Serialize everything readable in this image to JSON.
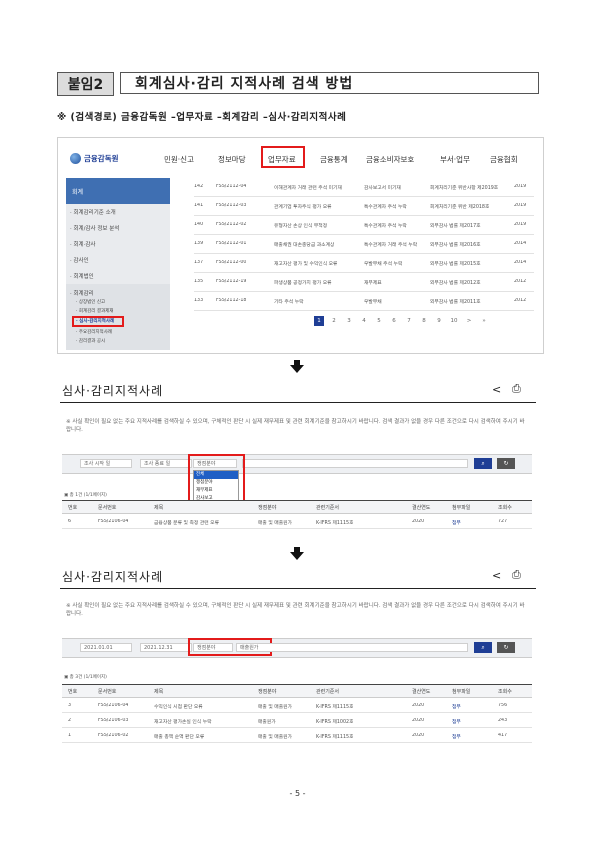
{
  "header": {
    "badge": "붙임2",
    "title": "회계심사·감리 지적사례 검색 방법"
  },
  "search_path": "※ (검색경로) 금융감독원 –업무자료 –회계감리 –심사·감리지적사례",
  "site": {
    "logo_text": "금융감독원",
    "nav": [
      "민원·신고",
      "정보마당",
      "업무자료",
      "금융통계",
      "금융소비자보호",
      "부서·업무",
      "금융협회"
    ],
    "sidebar_title": "회계",
    "sidebar_items": [
      "· 회계감리기준 소개",
      "· 회계/감사 정보 분석",
      "· 회계·감사",
      "· 감사인",
      "· 회계법인",
      "· 회계감리"
    ],
    "sidebar_subitems": [
      "· 상장법인 신고",
      "· 회계감리 결과제재",
      "· 심사·감리지적사례",
      "· 주요감리지적사례",
      "· 감리결과 공시"
    ],
    "list_rows": [
      [
        "142",
        "FSS/2112-04",
        "이해관계자 거래 관련 주석 미기재",
        "감사보고서 미기재",
        "회계처리기준 위반사항 제2019호",
        "2019"
      ],
      [
        "141",
        "FSS/2112-03",
        "관계기업 투자주식 평가 오류",
        "특수관계자 주석 누락",
        "회계처리기준 위반 제2018호",
        "2019"
      ],
      [
        "140",
        "FSS/2112-02",
        "유형자산 손상 인식 부적정",
        "특수관계자 주석 누락",
        "외부감사 법률 제2017호",
        "2019"
      ],
      [
        "139",
        "FSS/2112-01",
        "매출채권 대손충당금 과소계상",
        "특수관계자 거래 주석 누락",
        "외부감사 법률 제2016호",
        "2014"
      ],
      [
        "137",
        "FSS/2112-00",
        "재고자산 평가 및 수익인식 오류",
        "우발부채 주석 누락",
        "외부감사 법률 제2015호",
        "2014"
      ],
      [
        "135",
        "FSS/2112-19",
        "파생상품 공정가치 평가 오류",
        "재무제표",
        "외부감사 법률 제2012호",
        "2012"
      ],
      [
        "133",
        "FSS/2112-18",
        "기타 주석 누락",
        "우발부채",
        "외부감사 법률 제2011호",
        "2012"
      ]
    ],
    "pages": [
      "1",
      "2",
      "3",
      "4",
      "5",
      "6",
      "7",
      "8",
      "9",
      "10",
      ">",
      "»"
    ]
  },
  "panel1": {
    "title": "심사·감리지적사례",
    "notice": "※ 사실 확인이 필요 없는 주요 지적사례를 검색하실 수 있으며, 구체적인 판단 시 실제 재무제표 및 관련 회계기준을 참고하시기 바랍니다. 검색 결과가 없을 경우 다른 조건으로 다시 검색하여 주시기 바랍니다.",
    "date_from": "조사 시작 일",
    "date_to": "조사 종료 일",
    "select_value": "쟁점분야",
    "dropdown_options": [
      "전체",
      "쟁점분야",
      "재무제표",
      "감사보고"
    ],
    "count": "▣ 총 1건 (1/1페이지)",
    "columns": [
      "번호",
      "문서번호",
      "제목",
      "쟁점분야",
      "관련기준서",
      "결산연도",
      "첨부파일",
      "조회수"
    ],
    "rows": [
      [
        "6",
        "FSS/2106-04",
        "금융상품 분류 및 측정 관련 오류",
        "매출 및 매출원가",
        "K-IFRS 제1115호",
        "2020",
        "첨부",
        "727"
      ]
    ]
  },
  "panel2": {
    "title": "심사·감리지적사례",
    "notice": "※ 사실 확인이 필요 없는 주요 지적사례를 검색하실 수 있으며, 구체적인 판단 시 실제 재무제표 및 관련 회계기준을 참고하시기 바랍니다. 검색 결과가 없을 경우 다른 조건으로 다시 검색하여 주시기 바랍니다.",
    "date_from": "2021.01.01",
    "date_to": "2021.12.31",
    "select_value": "쟁점분야",
    "keyword": "매출원가",
    "count": "▣ 총 3건 (1/1페이지)",
    "columns": [
      "번호",
      "문서번호",
      "제목",
      "쟁점분야",
      "관련기준서",
      "결산연도",
      "첨부파일",
      "조회수"
    ],
    "rows": [
      [
        "3",
        "FSS/2106-04",
        "수익인식 시점 판단 오류",
        "매출 및 매출원가",
        "K-IFRS 제1115호",
        "2020",
        "첨부",
        "756"
      ],
      [
        "2",
        "FSS/2106-03",
        "재고자산 평가손실 인식 누락",
        "매출원가",
        "K-IFRS 제1002호",
        "2020",
        "첨부",
        "243"
      ],
      [
        "1",
        "FSS/2106-02",
        "매출 총액 순액 판단 오류",
        "매출 및 매출원가",
        "K-IFRS 제1115호",
        "2020",
        "첨부",
        "417"
      ]
    ]
  },
  "page_number": "- 5 -"
}
